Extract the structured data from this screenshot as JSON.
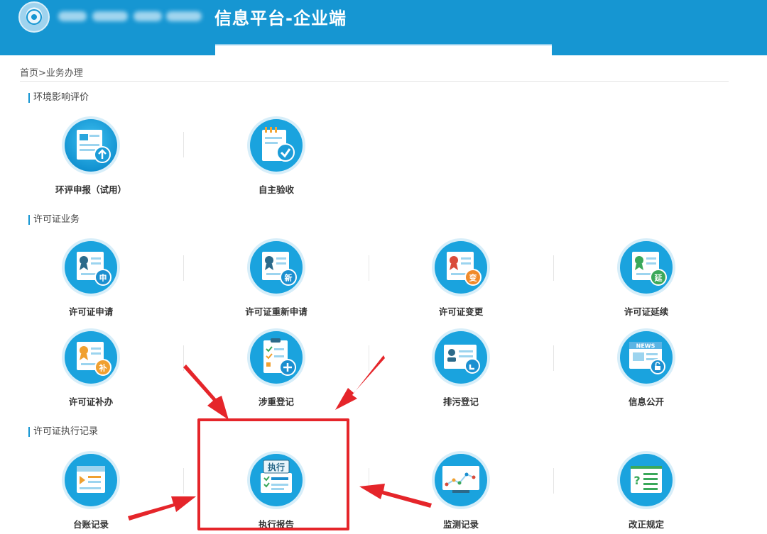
{
  "header": {
    "title": "信息平台-企业端",
    "logo_icon": "emblem-icon"
  },
  "breadcrumb": "首页>业务办理",
  "sections": [
    {
      "title": "环境影响评价",
      "items": [
        {
          "label": "环评申报（试用）",
          "icon": "eia-report-upload-icon"
        },
        {
          "label": "自主验收",
          "icon": "self-acceptance-check-icon"
        }
      ]
    },
    {
      "title": "许可证业务",
      "items": [
        {
          "label": "许可证申请",
          "icon": "license-apply-icon",
          "badge": "申"
        },
        {
          "label": "许可证重新申请",
          "icon": "license-reapply-icon",
          "badge": "新"
        },
        {
          "label": "许可证变更",
          "icon": "license-change-icon",
          "badge": "变"
        },
        {
          "label": "许可证延续",
          "icon": "license-extend-icon",
          "badge": "延"
        },
        {
          "label": "许可证补办",
          "icon": "license-reissue-icon",
          "badge": "补"
        },
        {
          "label": "涉重登记",
          "icon": "heavy-metal-register-icon"
        },
        {
          "label": "排污登记",
          "icon": "discharge-register-icon"
        },
        {
          "label": "信息公开",
          "icon": "info-disclosure-icon",
          "badge": "NEWS"
        }
      ]
    },
    {
      "title": "许可证执行记录",
      "items": [
        {
          "label": "台账记录",
          "icon": "ledger-record-icon"
        },
        {
          "label": "执行报告",
          "icon": "execution-report-icon",
          "badge": "执行"
        },
        {
          "label": "监测记录",
          "icon": "monitoring-record-icon"
        },
        {
          "label": "改正规定",
          "icon": "correction-rule-icon"
        }
      ]
    }
  ],
  "colors": {
    "header": "#1696d2",
    "icon_circle": "#1aa3de",
    "highlight": "#e5252a",
    "badge_orange": "#f08a2a",
    "badge_green": "#3aa85a"
  }
}
